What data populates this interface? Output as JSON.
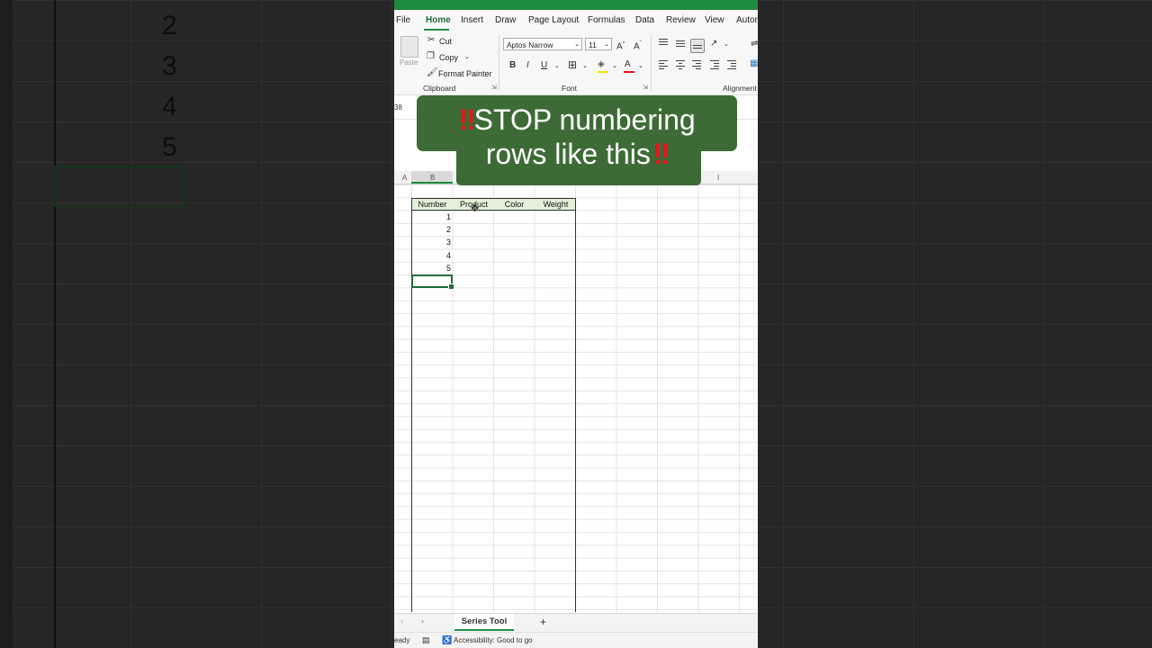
{
  "background": {
    "numbers": [
      "2",
      "3",
      "4",
      "5"
    ]
  },
  "menu": {
    "items": [
      "File",
      "Home",
      "Insert",
      "Draw",
      "Page Layout",
      "Formulas",
      "Data",
      "Review",
      "View",
      "Autom"
    ]
  },
  "ribbon": {
    "paste_label": "Paste",
    "cut_label": "Cut",
    "copy_label": "Copy",
    "format_painter_label": "Format Painter",
    "clipboard_group": "Clipboard",
    "font_name": "Aptos Narrow",
    "font_size": "11",
    "font_group": "Font",
    "alignment_group": "Alignment",
    "bold": "B",
    "italic": "I",
    "underline": "U"
  },
  "namebox": {
    "value": "38"
  },
  "column_headers": [
    "A",
    "B",
    "I"
  ],
  "table": {
    "headers": [
      "Number",
      "Product",
      "Color",
      "Weight"
    ],
    "numbers": [
      "1",
      "2",
      "3",
      "4",
      "5"
    ]
  },
  "sheet_tabs": {
    "active": "Series Tool",
    "add": "+"
  },
  "status": {
    "ready": "eady",
    "accessibility": "Accessibility: Good to go"
  },
  "caption": {
    "line1": "STOP numbering",
    "line2": "rows like this",
    "emoji": "‼"
  },
  "colors": {
    "excel_green": "#1e8b3e",
    "header_fill": "#e2f0d9",
    "caption_bg": "#3d6b35",
    "alarm_red": "#e8151b"
  }
}
